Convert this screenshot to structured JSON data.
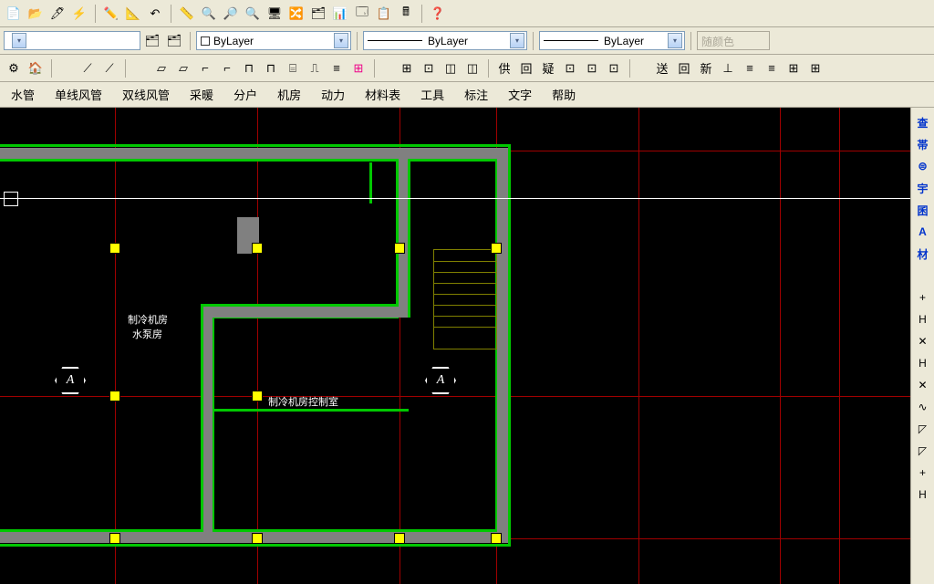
{
  "toolbar_row1_icons": [
    "📄",
    "📂",
    "🖊",
    "⚡",
    "✏️",
    "📐",
    "↶",
    "📏",
    "🔍",
    "🔎",
    "🔍",
    "🖥",
    "🔀",
    "🗂",
    "📊",
    "🗔",
    "📋",
    "🖩",
    "❓"
  ],
  "layer_dropdown": {
    "label": "ByLayer"
  },
  "linetype_dropdown": {
    "label": "ByLayer"
  },
  "lineweight_dropdown": {
    "label": "ByLayer"
  },
  "color_disabled": {
    "label": "随颜色"
  },
  "toolbar_row2_left_icons": [
    "⚙",
    "🏠"
  ],
  "toolbar_row2_group1": [
    "⟋",
    "⟋"
  ],
  "toolbar_row2_group2": [
    "▱",
    "▱",
    "⌐",
    "⌐",
    "⊓",
    "⊓",
    "⌸",
    "⎍",
    "≡",
    "⊞"
  ],
  "toolbar_row2_group3": [
    "⊞",
    "⊡",
    "◫",
    "◫"
  ],
  "toolbar_row2_group4": [
    "供",
    "回",
    "疑",
    "⊡",
    "⊡",
    "⊡"
  ],
  "toolbar_row2_group5": [
    "送",
    "回",
    "新",
    "⊥",
    "≡",
    "≡",
    "⊞",
    "⊞"
  ],
  "menu": [
    "水管",
    "单线风管",
    "双线风管",
    "采暖",
    "分户",
    "机房",
    "动力",
    "材料表",
    "工具",
    "标注",
    "文字",
    "帮助"
  ],
  "right_panel": [
    {
      "t": "查",
      "blue": true
    },
    {
      "t": "帯",
      "blue": true
    },
    {
      "t": "⊜",
      "blue": true
    },
    {
      "t": "宇",
      "blue": true
    },
    {
      "t": "囷",
      "blue": true
    },
    {
      "t": "A",
      "blue": true
    },
    {
      "t": "材",
      "blue": true
    },
    {
      "t": "+",
      "blue": false
    },
    {
      "t": "H",
      "blue": false
    },
    {
      "t": "✕",
      "blue": false
    },
    {
      "t": "H",
      "blue": false
    },
    {
      "t": "✕",
      "blue": false
    },
    {
      "t": "∿",
      "blue": false
    },
    {
      "t": "◸",
      "blue": false
    },
    {
      "t": "◸",
      "blue": false
    },
    {
      "t": "+",
      "blue": false
    },
    {
      "t": "H",
      "blue": false
    }
  ],
  "canvas": {
    "label1": "制冷机房",
    "label2": "水泵房",
    "label3": "制冷机房控制室",
    "axis_a": "A"
  }
}
